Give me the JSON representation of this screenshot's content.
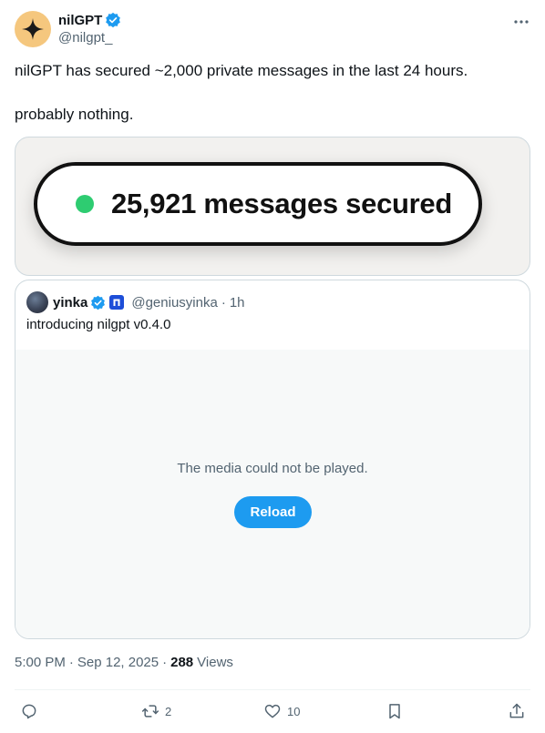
{
  "author": {
    "display_name": "nilGPT",
    "handle": "@nilgpt_",
    "verified": true
  },
  "tweet": {
    "line1": "nilGPT has secured ~2,000 private messages in the last 24 hours.",
    "line2": "probably nothing."
  },
  "media_card": {
    "count_text": "25,921 messages secured",
    "status_color": "#2ecc71"
  },
  "quoted": {
    "display_name": "yinka",
    "handle": "@geniusyinka",
    "separator": "·",
    "time": "1h",
    "text": "introducing nilgpt v0.4.0",
    "media_error": "The media could not be played.",
    "reload_label": "Reload"
  },
  "meta": {
    "time": "5:00 PM",
    "separator": "·",
    "date": "Sep 12, 2025",
    "views_count": "288",
    "views_label": "Views"
  },
  "actions": {
    "reply_count": "",
    "retweet_count": "2",
    "like_count": "10"
  },
  "colors": {
    "accent": "#1d9bf0",
    "verified": "#1d9bf0",
    "secondary_text": "#536471"
  },
  "icons": [
    "sparkle-icon",
    "verified-icon",
    "more-icon",
    "affiliate-badge-icon",
    "reply-icon",
    "retweet-icon",
    "like-icon",
    "bookmark-icon",
    "share-icon"
  ]
}
